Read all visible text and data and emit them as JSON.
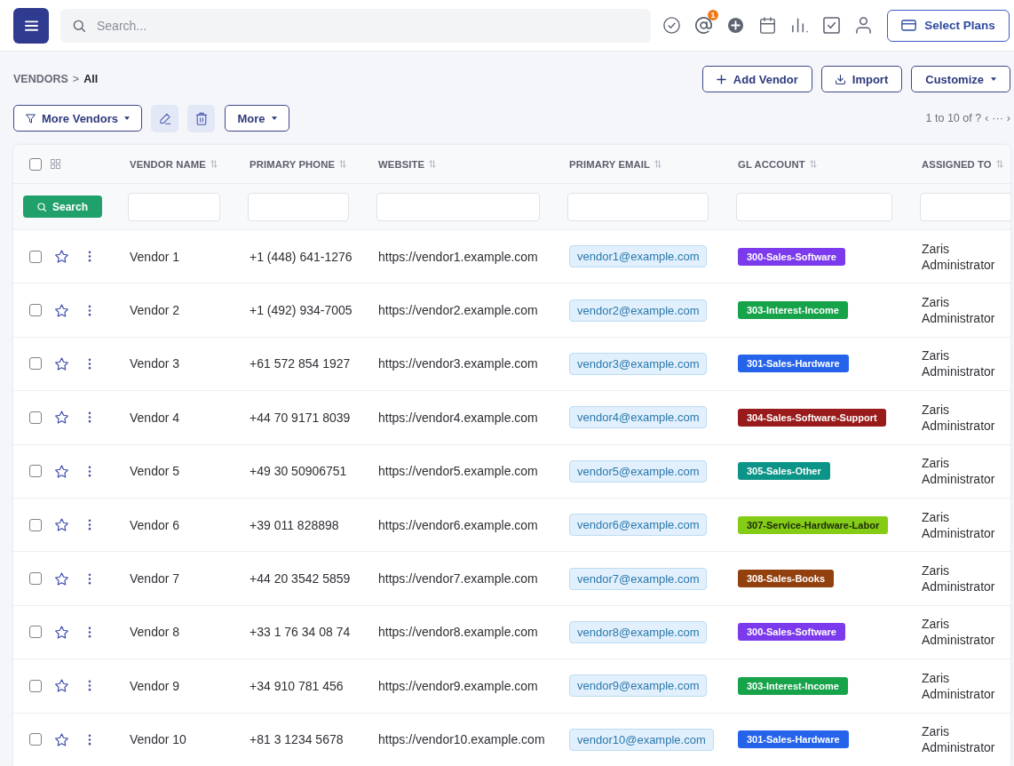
{
  "topbar": {
    "search": {
      "placeholder": "Search..."
    },
    "notification_badge": "1",
    "plans_button": "Select Plans"
  },
  "breadcrumb": {
    "items": [
      "VENDORS",
      "All"
    ],
    "separator": ">"
  },
  "actions": [
    {
      "kind": "add",
      "label": "Add Vendor"
    },
    {
      "kind": "import",
      "label": "Import"
    },
    {
      "kind": "dropdown",
      "label": "Customize"
    }
  ],
  "filters_bar": {
    "filter_button": "More Vendors",
    "more_button": "More",
    "pagination": {
      "range": "1 to 10 of ?",
      "prev": "‹",
      "more": "···",
      "next": "›"
    }
  },
  "table": {
    "all_checked": false,
    "columns": [
      "VENDOR NAME",
      "PRIMARY PHONE",
      "WEBSITE",
      "PRIMARY EMAIL",
      "GL ACCOUNT",
      "ASSIGNED TO"
    ],
    "search_button": "Search",
    "rows": [
      {
        "checked": false,
        "starred": false,
        "name": "Vendor 1",
        "phone": "+1 (448) 641-1276",
        "website": "https://vendor1.example.com",
        "email": "vendor1@example.com",
        "gl_account": {
          "label": "300-Sales-Software",
          "color": "#7c3aed"
        },
        "assigned_to": "Zaris Administrator"
      },
      {
        "checked": false,
        "starred": false,
        "name": "Vendor 2",
        "phone": "+1 (492) 934-7005",
        "website": "https://vendor2.example.com",
        "email": "vendor2@example.com",
        "gl_account": {
          "label": "303-Interest-Income",
          "color": "#16a34a"
        },
        "assigned_to": "Zaris Administrator"
      },
      {
        "checked": false,
        "starred": false,
        "name": "Vendor 3",
        "phone": "+61 572 854 1927",
        "website": "https://vendor3.example.com",
        "email": "vendor3@example.com",
        "gl_account": {
          "label": "301-Sales-Hardware",
          "color": "#2563eb"
        },
        "assigned_to": "Zaris Administrator"
      },
      {
        "checked": false,
        "starred": false,
        "name": "Vendor 4",
        "phone": "+44 70 9171 8039",
        "website": "https://vendor4.example.com",
        "email": "vendor4@example.com",
        "gl_account": {
          "label": "304-Sales-Software-Support",
          "color": "#991b1b"
        },
        "assigned_to": "Zaris Administrator"
      },
      {
        "checked": false,
        "starred": false,
        "name": "Vendor 5",
        "phone": "+49 30 50906751",
        "website": "https://vendor5.example.com",
        "email": "vendor5@example.com",
        "gl_account": {
          "label": "305-Sales-Other",
          "color": "#0d9488"
        },
        "assigned_to": "Zaris Administrator"
      },
      {
        "checked": false,
        "starred": false,
        "name": "Vendor 6",
        "phone": "+39 011 828898",
        "website": "https://vendor6.example.com",
        "email": "vendor6@example.com",
        "gl_account": {
          "label": "307-Service-Hardware-Labor",
          "color": "#84cc16"
        },
        "assigned_to": "Zaris Administrator"
      },
      {
        "checked": false,
        "starred": false,
        "name": "Vendor 7",
        "phone": "+44 20 3542 5859",
        "website": "https://vendor7.example.com",
        "email": "vendor7@example.com",
        "gl_account": {
          "label": "308-Sales-Books",
          "color": "#92400e"
        },
        "assigned_to": "Zaris Administrator"
      },
      {
        "checked": false,
        "starred": false,
        "name": "Vendor 8",
        "phone": "+33 1 76 34 08 74",
        "website": "https://vendor8.example.com",
        "email": "vendor8@example.com",
        "gl_account": {
          "label": "300-Sales-Software",
          "color": "#7c3aed"
        },
        "assigned_to": "Zaris Administrator"
      },
      {
        "checked": false,
        "starred": false,
        "name": "Vendor 9",
        "phone": "+34 910 781 456",
        "website": "https://vendor9.example.com",
        "email": "vendor9@example.com",
        "gl_account": {
          "label": "303-Interest-Income",
          "color": "#16a34a"
        },
        "assigned_to": "Zaris Administrator"
      },
      {
        "checked": false,
        "starred": false,
        "name": "Vendor 10",
        "phone": "+81 3 1234 5678",
        "website": "https://vendor10.example.com",
        "email": "vendor10@example.com",
        "gl_account": {
          "label": "301-Sales-Hardware",
          "color": "#2563eb"
        },
        "assigned_to": "Zaris Administrator"
      }
    ]
  }
}
